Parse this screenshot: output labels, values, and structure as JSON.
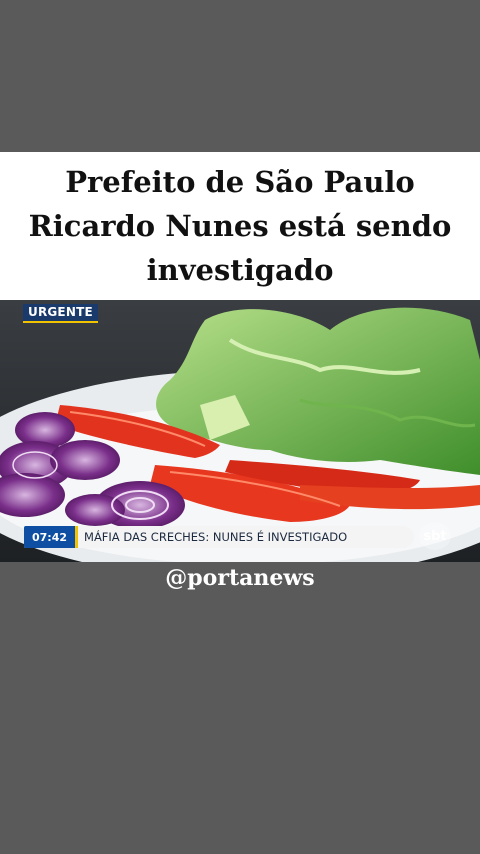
{
  "headline": {
    "line1": "Prefeito de São Paulo",
    "line2": "Ricardo Nunes está sendo",
    "line3": "investigado"
  },
  "video": {
    "badge": "URGENTE",
    "ticker_time": "07:42",
    "ticker_text": "MÁFIA DAS CRECHES: NUNES É INVESTIGADO",
    "channel_logo": "sbt"
  },
  "footer": {
    "handle": "@portanews"
  },
  "colors": {
    "background": "#5a5a5a",
    "headline_bg": "#ffffff",
    "ticker_blue": "#0e4fa3",
    "accent_yellow": "#f2c400"
  }
}
